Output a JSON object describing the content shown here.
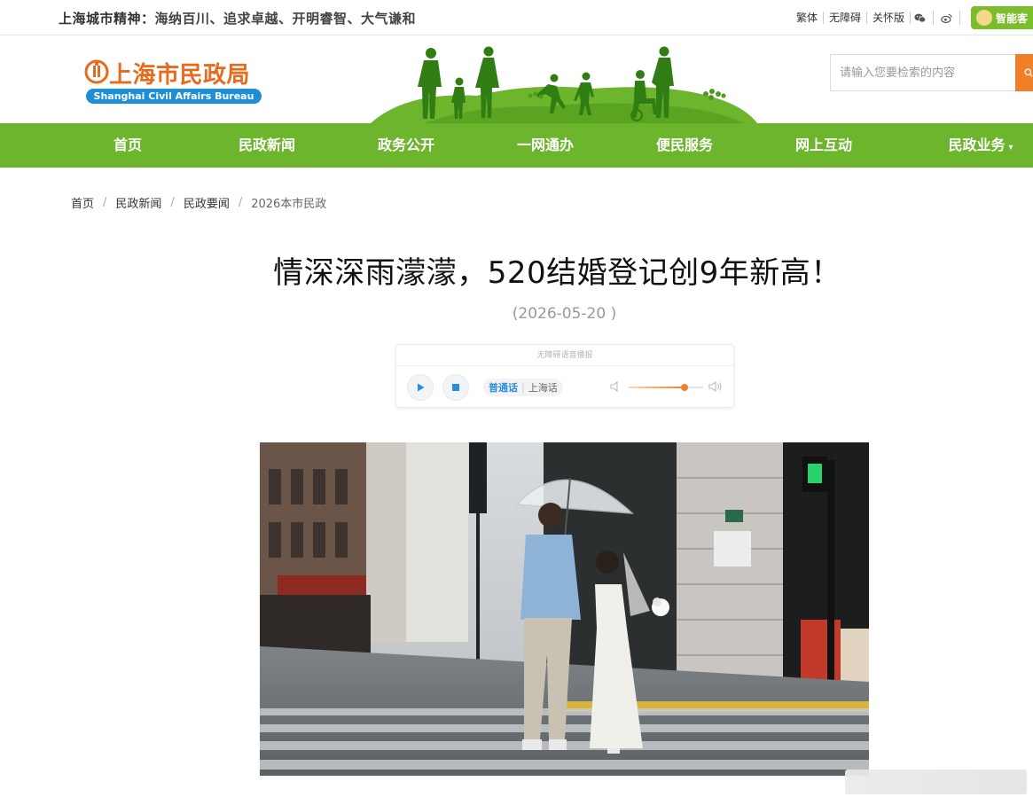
{
  "topbar": {
    "slogan_label": "上海城市精神：",
    "slogan_text": "海纳百川、追求卓越、开明睿智、大气谦和",
    "links": [
      "繁体",
      "无障碍",
      "关怀版"
    ],
    "wechat_icon": "wechat-icon",
    "weibo_icon": "weibo-icon",
    "ai_button": "智能客"
  },
  "header": {
    "logo_title": "上海市民政局",
    "logo_subtitle": "Shanghai Civil Affairs Bureau",
    "search_placeholder": "请输入您要检索的内容"
  },
  "nav": {
    "items": [
      "首页",
      "民政新闻",
      "政务公开",
      "一网通办",
      "便民服务",
      "网上互动",
      "民政业务"
    ]
  },
  "breadcrumb": [
    "首页",
    "民政新闻",
    "民政要闻",
    "2026本市民政"
  ],
  "article": {
    "title": "情深深雨濛濛，520结婚登记创9年新高！",
    "date": "(2026-05-20 )"
  },
  "player": {
    "caption": "无障碍语音播报",
    "languages": [
      "普通话",
      "上海话"
    ],
    "selected_language": "普通话",
    "volume": 0.75
  },
  "colors": {
    "nav_green": "#6cb52d",
    "brand_orange": "#e86a1e",
    "accent_orange": "#f07f26",
    "logo_blue": "#1d8fd6",
    "ai_green": "#7bbd2a"
  }
}
